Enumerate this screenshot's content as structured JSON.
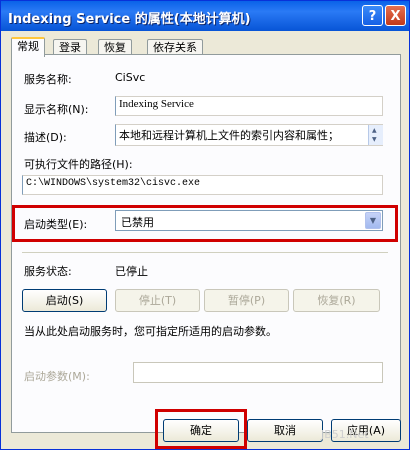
{
  "window": {
    "title": "Indexing Service 的属性(本地计算机)",
    "help_label": "?",
    "close_label": "X"
  },
  "tabs": [
    {
      "label": "常规",
      "active": true
    },
    {
      "label": "登录",
      "active": false
    },
    {
      "label": "恢复",
      "active": false
    },
    {
      "label": "依存关系",
      "active": false
    }
  ],
  "general": {
    "service_name_label": "服务名称:",
    "service_name_value": "CiSvc",
    "display_name_label": "显示名称(N):",
    "display_name_value": "Indexing Service",
    "description_label": "描述(D):",
    "description_value": "本地和远程计算机上文件的索引内容和属性；",
    "exe_path_label": "可执行文件的路径(H):",
    "exe_path_value": "C:\\WINDOWS\\system32\\cisvc.exe",
    "startup_type_label": "启动类型(E):",
    "startup_type_value": "已禁用",
    "status_label": "服务状态:",
    "status_value": "已停止",
    "start_button": "启动(S)",
    "stop_button": "停止(T)",
    "pause_button": "暂停(P)",
    "resume_button": "恢复(R)",
    "hint_text": "当从此处启动服务时，您可指定所适用的启动参数。",
    "params_label": "启动参数(M):",
    "params_value": ""
  },
  "footer": {
    "ok_button": "确定",
    "cancel_button": "取消",
    "apply_button": "应用(A)"
  },
  "watermark": "JB51.Net",
  "colors": {
    "titlebar": "#0a62e8",
    "highlight_box": "#d00000",
    "tab_accent": "#ffc73c"
  }
}
